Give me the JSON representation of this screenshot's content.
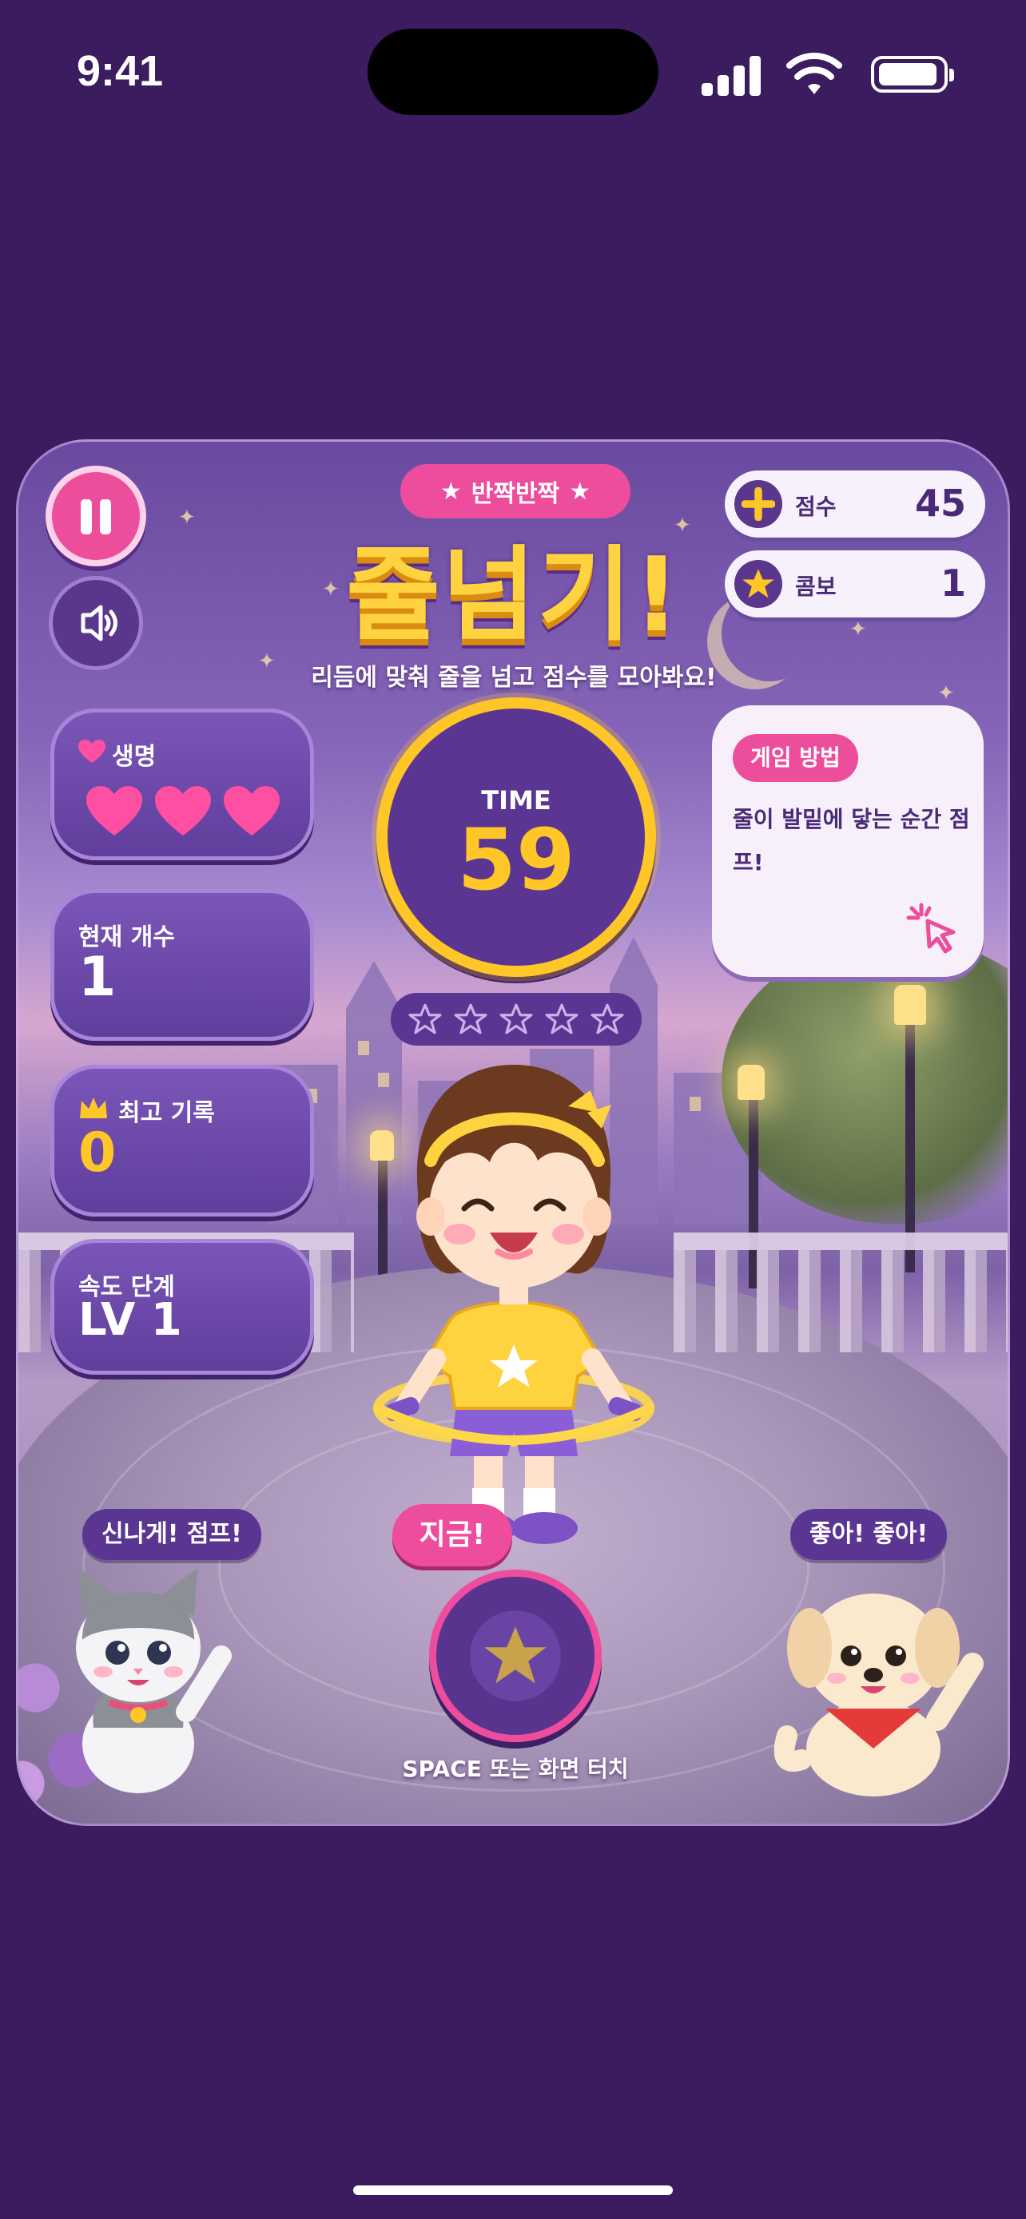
{
  "status_bar": {
    "time": "9:41"
  },
  "header": {
    "badge": "반짝반짝",
    "title": "줄넘기!",
    "description": "리듬에 맞춰 줄을 넘고 점수를 모아봐요!"
  },
  "scores": [
    {
      "label": "점수",
      "value": "45",
      "icon": "plus-icon"
    },
    {
      "label": "콤보",
      "value": "1",
      "icon": "star-icon"
    }
  ],
  "stats": {
    "lives": {
      "label": "생명",
      "count": 3,
      "max": 3
    },
    "current": {
      "label": "현재 개수",
      "value": "1"
    },
    "best": {
      "label": "최고 기록",
      "value": "0"
    },
    "speed": {
      "label": "속도 단계",
      "value": "LV 1"
    }
  },
  "timer": {
    "label": "TIME",
    "value": "59"
  },
  "stars": {
    "filled": 0,
    "total": 5
  },
  "howto": {
    "badge": "게임 방법",
    "text": "줄이 발밑에 닿는 순간 점프!"
  },
  "bubbles": {
    "cat": "신나게! 점프!",
    "dog": "좋아! 좋아!"
  },
  "action": {
    "now_label": "지금!",
    "hint": "SPACE 또는 화면 터치"
  },
  "colors": {
    "background": "#3b1c5e",
    "accent_pink": "#ee4c9d",
    "accent_yellow": "#ffc628",
    "panel_purple": "#5b3592"
  }
}
